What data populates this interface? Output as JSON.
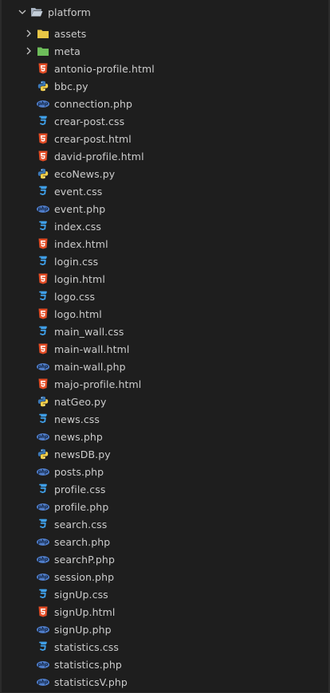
{
  "explorer": {
    "root": {
      "label": "platform",
      "icon": "folder-open-icon",
      "expanded": true
    },
    "folders": [
      {
        "label": "assets",
        "icon": "folder-yellow-icon",
        "color": "#e8c546"
      },
      {
        "label": "meta",
        "icon": "folder-green-icon",
        "color": "#6ebd5a"
      }
    ],
    "files": [
      {
        "label": "antonio-profile.html",
        "type": "html"
      },
      {
        "label": "bbc.py",
        "type": "py"
      },
      {
        "label": "connection.php",
        "type": "php"
      },
      {
        "label": "crear-post.css",
        "type": "css"
      },
      {
        "label": "crear-post.html",
        "type": "html"
      },
      {
        "label": "david-profile.html",
        "type": "html"
      },
      {
        "label": "ecoNews.py",
        "type": "py"
      },
      {
        "label": "event.css",
        "type": "css"
      },
      {
        "label": "event.php",
        "type": "php"
      },
      {
        "label": "index.css",
        "type": "css"
      },
      {
        "label": "index.html",
        "type": "html"
      },
      {
        "label": "login.css",
        "type": "css"
      },
      {
        "label": "login.html",
        "type": "html"
      },
      {
        "label": "logo.css",
        "type": "css"
      },
      {
        "label": "logo.html",
        "type": "html"
      },
      {
        "label": "main_wall.css",
        "type": "css"
      },
      {
        "label": "main-wall.html",
        "type": "html"
      },
      {
        "label": "main-wall.php",
        "type": "php"
      },
      {
        "label": "majo-profile.html",
        "type": "html"
      },
      {
        "label": "natGeo.py",
        "type": "py"
      },
      {
        "label": "news.css",
        "type": "css"
      },
      {
        "label": "news.php",
        "type": "php"
      },
      {
        "label": "newsDB.py",
        "type": "py"
      },
      {
        "label": "posts.php",
        "type": "php"
      },
      {
        "label": "profile.css",
        "type": "css"
      },
      {
        "label": "profile.php",
        "type": "php"
      },
      {
        "label": "search.css",
        "type": "css"
      },
      {
        "label": "search.php",
        "type": "php"
      },
      {
        "label": "searchP.php",
        "type": "php"
      },
      {
        "label": "session.php",
        "type": "php"
      },
      {
        "label": "signUp.css",
        "type": "css"
      },
      {
        "label": "signUp.html",
        "type": "html"
      },
      {
        "label": "signUp.php",
        "type": "php"
      },
      {
        "label": "statistics.css",
        "type": "css"
      },
      {
        "label": "statistics.php",
        "type": "php"
      },
      {
        "label": "statisticsV.php",
        "type": "php"
      }
    ],
    "icon_names": {
      "html": "html-file-icon",
      "css": "css-file-icon",
      "php": "php-file-icon",
      "py": "python-file-icon"
    },
    "icon_text": {
      "php": "php"
    },
    "colors": {
      "html": "#e44d26",
      "css": "#3f9fe8",
      "php": "#4f7dc9",
      "py_blue": "#3d7ab8",
      "py_yellow": "#f5d04a"
    }
  }
}
